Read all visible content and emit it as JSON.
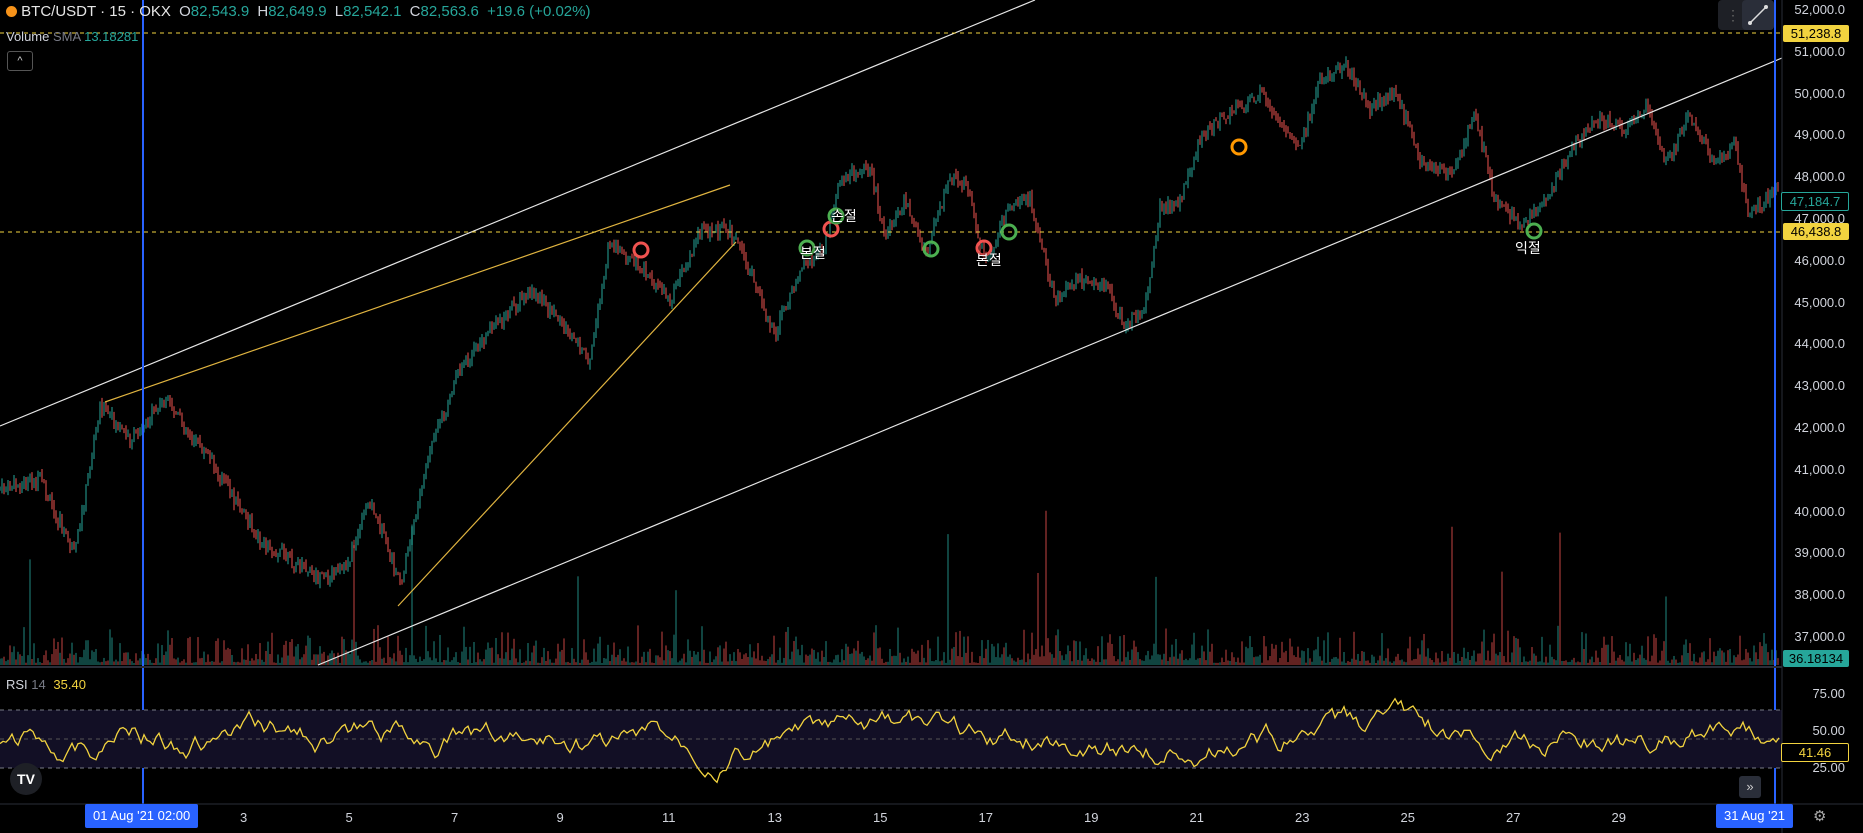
{
  "header": {
    "symbol": "BTC/USDT · 15 · OKX",
    "o_label": "O",
    "o_value": "82,543.9",
    "h_label": "H",
    "h_value": "82,649.9",
    "l_label": "L",
    "l_value": "82,542.1",
    "c_label": "C",
    "c_value": "82,563.6",
    "change": "+19.6 (+0.02%)"
  },
  "volume_legend": {
    "label": "Volume",
    "sma": "SMA",
    "value": "13.18281"
  },
  "rsi_legend": {
    "label": "RSI",
    "period": "14",
    "value": "35.40"
  },
  "price_axis": [
    "52,000.0",
    "51,000.0",
    "50,000.0",
    "49,000.0",
    "48,000.0",
    "47,000.0",
    "46,000.0",
    "45,000.0",
    "44,000.0",
    "43,000.0",
    "42,000.0",
    "41,000.0",
    "40,000.0",
    "39,000.0",
    "38,000.0",
    "37,000.0"
  ],
  "price_tags": {
    "upper_line": "51,238.8",
    "current": "47,184.7",
    "lower_line": "46,438.8",
    "volume": "36.18134"
  },
  "rsi_axis": [
    "75.00",
    "50.00",
    "25.00"
  ],
  "rsi_tag": "41.46",
  "time_axis": [
    "3",
    "5",
    "7",
    "9",
    "11",
    "13",
    "15",
    "17",
    "19",
    "21",
    "23",
    "25",
    "27",
    "29"
  ],
  "time_tags": {
    "start": "01 Aug '21   02:00",
    "end": "31 Aug '21"
  },
  "annotations": [
    "본절",
    "손절",
    "본절",
    "익절"
  ],
  "icons": {
    "logo": "tradingview-logo-icon",
    "forward": "scroll-forward-icon",
    "settings": "gear-icon",
    "drawing": "trend-line-tool-icon"
  },
  "colors": {
    "up": "#26a69a",
    "down": "#ef5350",
    "rsi": "#f2d33f",
    "accent": "#2962ff",
    "guide": "#f2d33f"
  }
}
